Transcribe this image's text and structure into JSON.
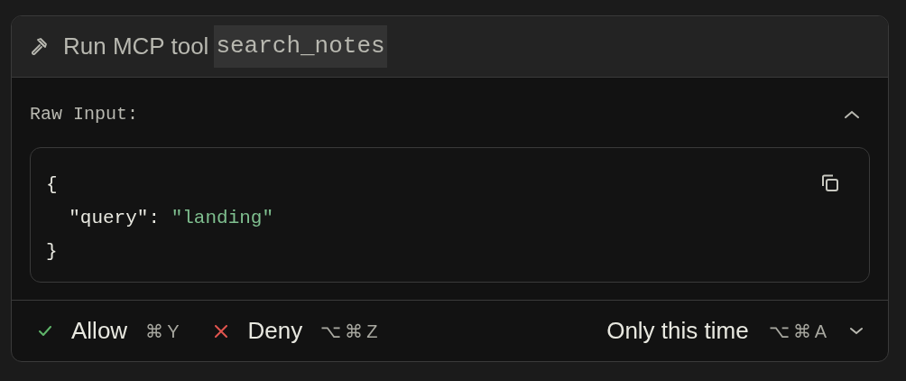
{
  "header": {
    "title": "Run MCP tool",
    "tool_name": "search_notes"
  },
  "input": {
    "label": "Raw Input:",
    "expanded": true,
    "lines": [
      [
        {
          "kind": "punct",
          "text": "{"
        }
      ],
      [
        {
          "kind": "key",
          "text": "  \"query\""
        },
        {
          "kind": "punct",
          "text": ": "
        },
        {
          "kind": "string",
          "text": "\"landing\""
        }
      ],
      [
        {
          "kind": "punct",
          "text": "}"
        }
      ]
    ]
  },
  "actions": [
    {
      "kind": "allow",
      "label": "Allow",
      "shortcut": "⌘Y"
    },
    {
      "kind": "deny",
      "label": "Deny",
      "shortcut": "⌥⌘Z"
    }
  ],
  "scope": {
    "label": "Only this time",
    "shortcut": "⌥⌘A"
  }
}
